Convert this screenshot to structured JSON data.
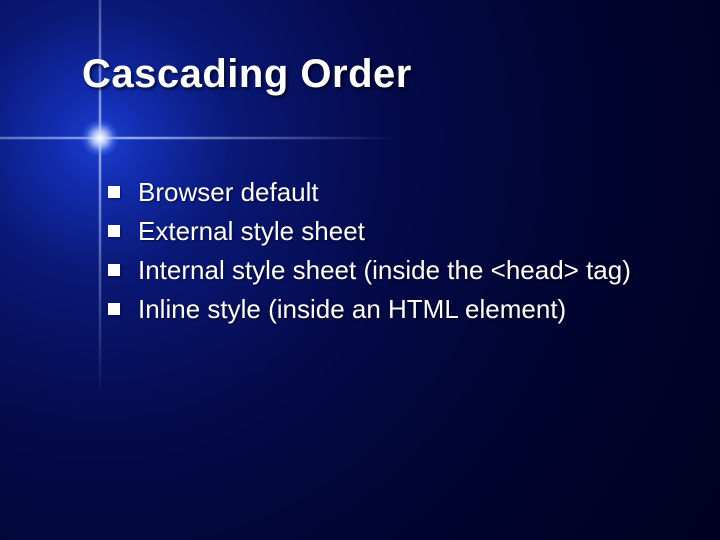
{
  "slide": {
    "title": "Cascading Order",
    "bullets": [
      "Browser default",
      "External style sheet",
      "Internal style sheet (inside the <head> tag)",
      "Inline style (inside an HTML element)"
    ]
  }
}
